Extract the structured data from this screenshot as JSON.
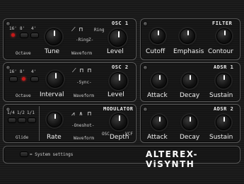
{
  "osc1": {
    "title": "OSC 1",
    "octave_options": [
      "16'",
      "8'",
      "4'"
    ],
    "octave_label": "Octave",
    "tune_label": "Tune",
    "ring_label": "Ring",
    "ringz_label": "-RingZ-",
    "waveform_label": "Waveform",
    "level_label": "Level"
  },
  "osc2": {
    "title": "OSC 2",
    "octave_options": [
      "16'",
      "8'",
      "4'"
    ],
    "octave_label": "Octave",
    "interval_label": "Interval",
    "sync_label": "-Sync-",
    "waveform_label": "Waveform",
    "level_label": "Level"
  },
  "modulator": {
    "title": "MODULATOR",
    "glide_options": [
      "1/4",
      "1/2",
      "1/1"
    ],
    "glide_label": "Glide",
    "rate_label": "Rate",
    "oneshot_label": "-Oneshot-",
    "waveform_label": "Waveform",
    "depth_label": "Depth",
    "osc_label": "OSC",
    "vcf_label": "VCF"
  },
  "filter": {
    "title": "FILTER",
    "cutoff_label": "Cutoff",
    "emphasis_label": "Emphasis",
    "contour_label": "Contour"
  },
  "adsr1": {
    "title": "ADSR 1",
    "attack_label": "Attack",
    "decay_label": "Decay",
    "sustain_label": "Sustain"
  },
  "adsr2": {
    "title": "ADSR 2",
    "attack_label": "Attack",
    "decay_label": "Decay",
    "sustain_label": "Sustain"
  },
  "footer": {
    "system_settings_label": "= System settings",
    "brand": "ALTEREX-ViSYNTH"
  },
  "colors": {
    "led": "#c81818",
    "panel_border": "#5a5a5a",
    "background": "#141414"
  }
}
